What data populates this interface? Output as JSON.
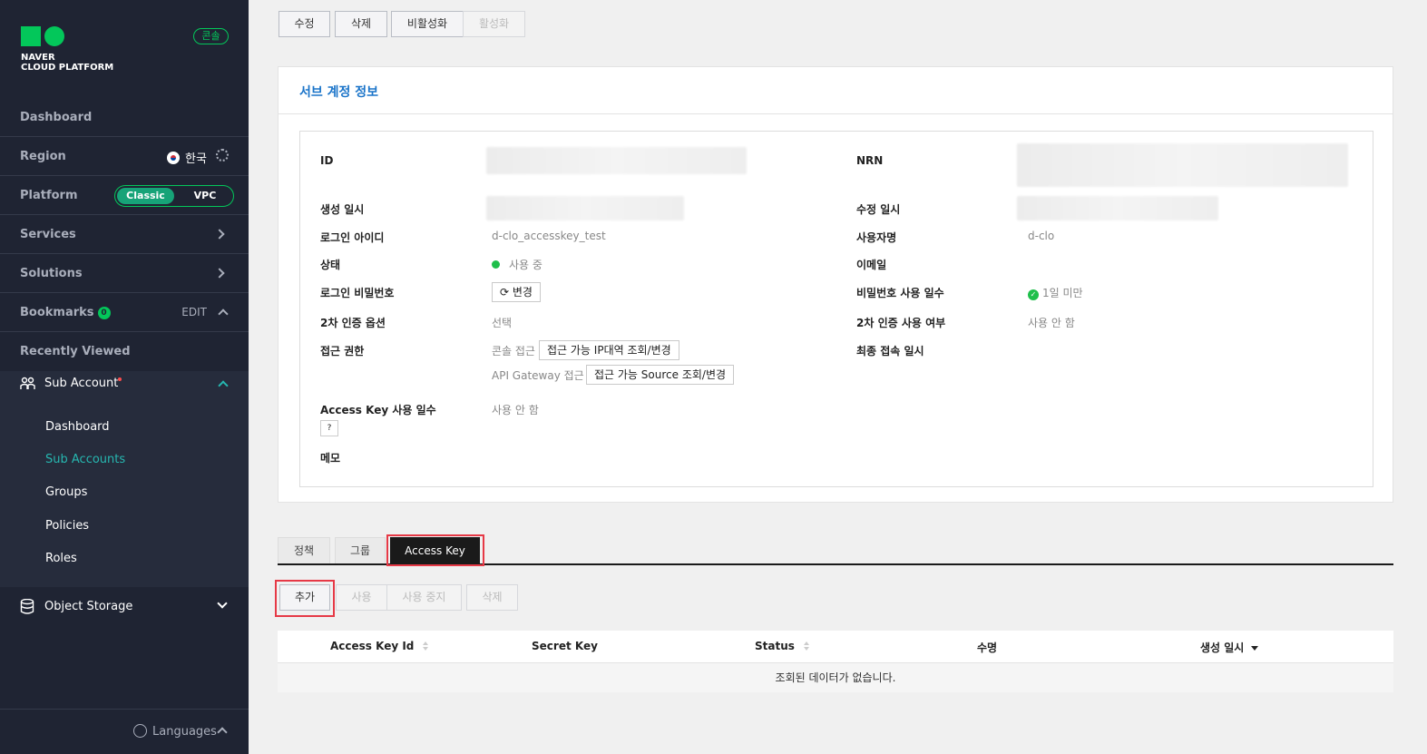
{
  "sidebar": {
    "brand_line1": "NAVER",
    "brand_line2": "CLOUD PLATFORM",
    "console_badge": "콘솔",
    "dashboard": "Dashboard",
    "region_label": "Region",
    "region_value": "한국",
    "platform_label": "Platform",
    "platform_classic": "Classic",
    "platform_vpc": "VPC",
    "services": "Services",
    "solutions": "Solutions",
    "bookmarks": "Bookmarks",
    "bookmarks_count": "0",
    "bookmarks_edit": "EDIT",
    "recently_viewed": "Recently Viewed",
    "sub_account": "Sub Account",
    "sub_items": [
      "Dashboard",
      "Sub Accounts",
      "Groups",
      "Policies",
      "Roles"
    ],
    "object_storage": "Object Storage",
    "languages": "Languages"
  },
  "toolbar": {
    "edit": "수정",
    "delete": "삭제",
    "deactivate": "비활성화",
    "activate": "활성화"
  },
  "panel": {
    "title": "서브 계정 정보",
    "left": {
      "id_label": "ID",
      "created_label": "생성 일시",
      "login_id_label": "로그인 아이디",
      "login_id_value": "d-clo_accesskey_test",
      "status_label": "상태",
      "status_value": "사용 중",
      "password_label": "로그인 비밀번호",
      "password_change": "변경",
      "mfa_option_label": "2차 인증 옵션",
      "mfa_option_value": "선택",
      "access_label": "접근 권한",
      "console_access": "콘솔 접근",
      "console_access_btn": "접근 가능 IP대역 조회/변경",
      "api_access": "API Gateway 접근",
      "api_access_btn": "접근 가능 Source 조회/변경",
      "ak_days_label": "Access Key 사용 일수",
      "ak_days_value": "사용 안 함",
      "memo_label": "메모"
    },
    "right": {
      "nrn_label": "NRN",
      "modified_label": "수정 일시",
      "username_label": "사용자명",
      "username_value": "d-clo",
      "email_label": "이메일",
      "pw_days_label": "비밀번호 사용 일수",
      "pw_days_value": "1일 미만",
      "mfa_use_label": "2차 인증 사용 여부",
      "mfa_use_value": "사용 안 함",
      "last_login_label": "최종 접속 일시"
    }
  },
  "tabs": [
    "정책",
    "그룹",
    "Access Key"
  ],
  "key_actions": {
    "add": "추가",
    "use": "사용",
    "stop": "사용 중지",
    "delete": "삭제"
  },
  "table": {
    "columns": [
      "Access Key Id",
      "Secret Key",
      "Status",
      "수명",
      "생성 일시"
    ],
    "empty": "조회된 데이터가 없습니다."
  },
  "colors": {
    "sidebar_bg": "#1f2433",
    "accent_green": "#03c75a",
    "highlight_red": "#e63946",
    "title_blue": "#1a74c9"
  }
}
